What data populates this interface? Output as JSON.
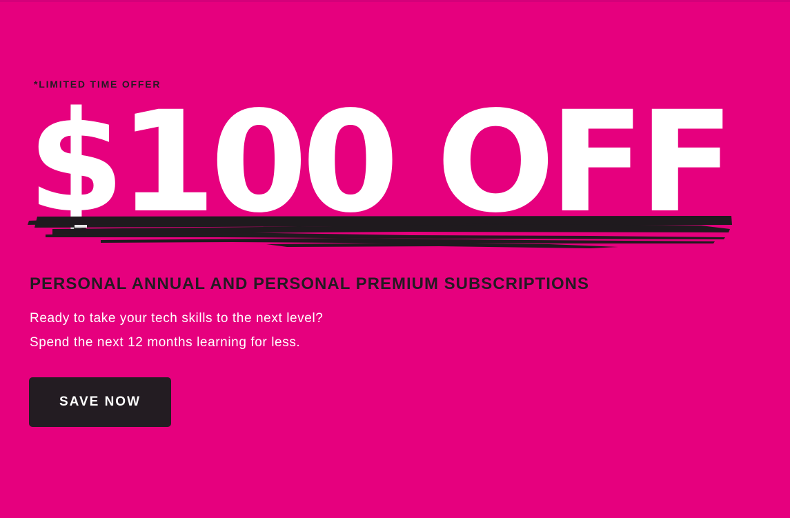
{
  "promo": {
    "eyebrow": "*LIMITED TIME OFFER",
    "headline": "$100 OFF",
    "subheadline": "PERSONAL ANNUAL AND PERSONAL PREMIUM SUBSCRIPTIONS",
    "description_line1": "Ready to take your tech skills to the next level?",
    "description_line2": "Spend the next 12 months learning for less.",
    "cta_label": "SAVE NOW"
  },
  "colors": {
    "background": "#e6007e",
    "headline": "#ffffff",
    "dark_text": "#241a22",
    "button": "#231c22",
    "brush_stroke": "#1f1a1e"
  }
}
